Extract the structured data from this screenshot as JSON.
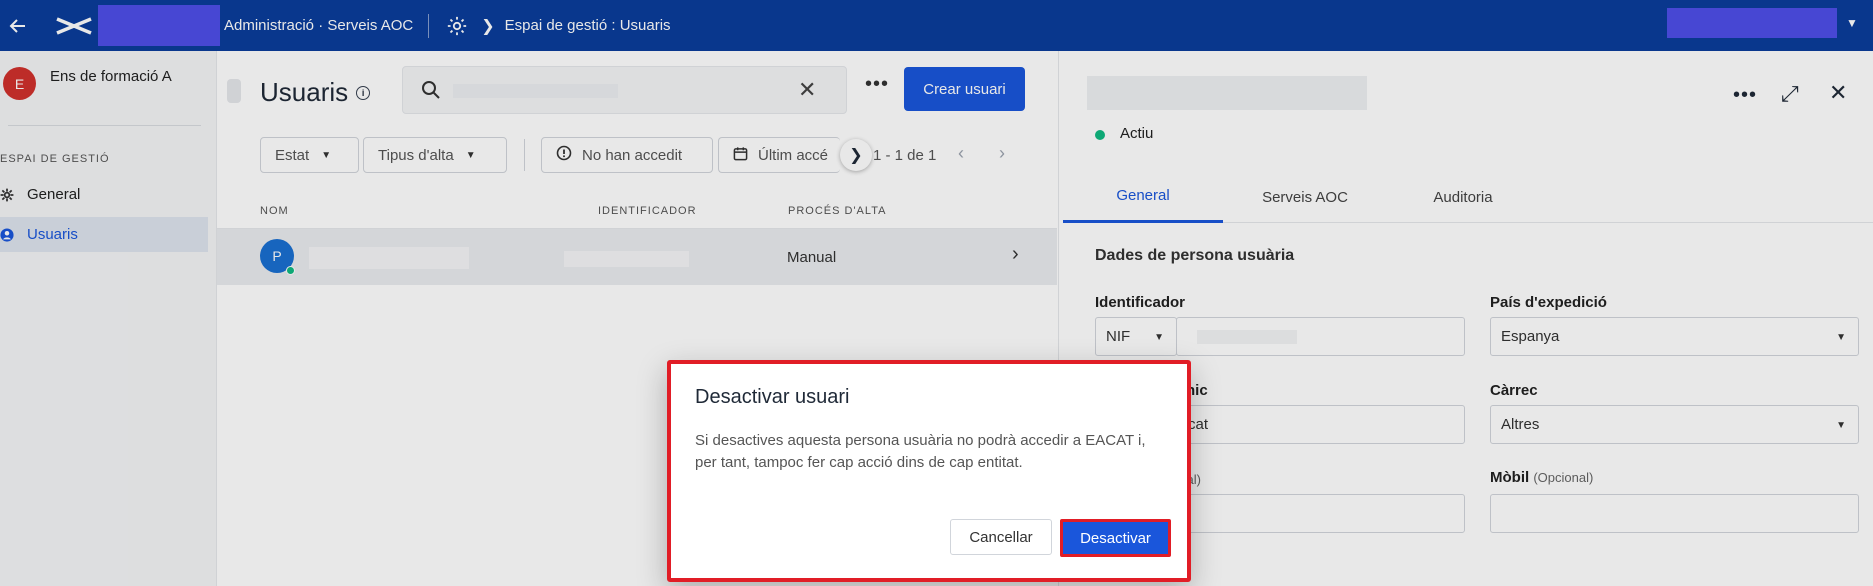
{
  "topbar": {
    "app_title": "Administració · Serveis AOC",
    "breadcrumb": "Espai de gestió : Usuaris",
    "colors": {
      "bar": "#0a3d9c",
      "blocked": "#4f4fe8"
    }
  },
  "sidebar": {
    "org_initial": "E",
    "org_name": "Ens de formació A",
    "section_label": "ESPAI DE GESTIÓ",
    "items": [
      {
        "label": "General",
        "icon": "gear-icon",
        "active": false
      },
      {
        "label": "Usuaris",
        "icon": "user-icon",
        "active": true
      }
    ]
  },
  "list": {
    "title": "Usuaris",
    "create_label": "Crear usuari",
    "filters": {
      "estat": "Estat",
      "tipus": "Tipus d'alta",
      "no_accedit": "No han accedit",
      "ultim": "Últim accé"
    },
    "pager": "1 - 1 de 1",
    "columns": {
      "nom": "NOM",
      "identificador": "IDENTIFICADOR",
      "proces": "PROCÉS D'ALTA"
    },
    "rows": [
      {
        "initial": "P",
        "proces": "Manual"
      }
    ]
  },
  "detail": {
    "status": "Actiu",
    "tabs": [
      {
        "label": "General",
        "active": true
      },
      {
        "label": "Serveis AOC",
        "active": false
      },
      {
        "label": "Auditoria",
        "active": false
      }
    ],
    "section_title": "Dades de persona usuària",
    "fields": {
      "identificador_label": "Identificador",
      "identificador_type": "NIF",
      "pais_label": "País d'expedició",
      "pais_value": "Espanya",
      "email_label_partial": "rònic",
      "email_value_partial": "oc.cat",
      "carrec_label": "Càrrec",
      "carrec_value": "Altres",
      "telefon_label_partial": "onal)",
      "mobil_label": "Mòbil",
      "optional": "(Opcional)"
    }
  },
  "dialog": {
    "title": "Desactivar usuari",
    "body": "Si desactives aquesta persona usuària no podrà accedir a EACAT i, per tant, tampoc fer cap acció dins de cap entitat.",
    "cancel_label": "Cancellar",
    "confirm_label": "Desactivar",
    "highlight_color": "#e11d26"
  }
}
